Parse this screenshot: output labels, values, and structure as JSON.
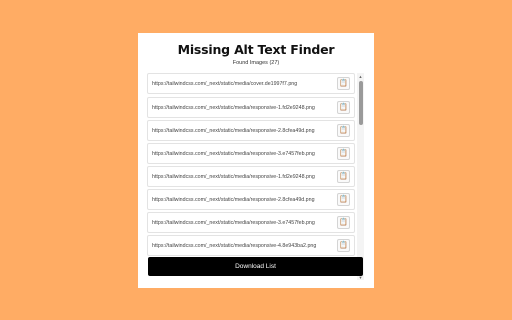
{
  "app": {
    "title": "Missing Alt Text Finder",
    "found_label": "Found Images (27)"
  },
  "images": [
    {
      "url": "https://tailwindcss.com/_next/static/media/cover.de1997f7.png"
    },
    {
      "url": "https://tailwindcss.com/_next/static/media/responsive-1.fd2e9248.png"
    },
    {
      "url": "https://tailwindcss.com/_next/static/media/responsive-2.8cfea49d.png"
    },
    {
      "url": "https://tailwindcss.com/_next/static/media/responsive-3.e7457feb.png"
    },
    {
      "url": "https://tailwindcss.com/_next/static/media/responsive-1.fd2e9248.png"
    },
    {
      "url": "https://tailwindcss.com/_next/static/media/responsive-2.8cfea49d.png"
    },
    {
      "url": "https://tailwindcss.com/_next/static/media/responsive-3.e7457feb.png"
    },
    {
      "url": "https://tailwindcss.com/_next/static/media/responsive-4.8e943ba2.png"
    }
  ],
  "icons": {
    "copy": "clipboard-icon",
    "scroll_up": "scroll-up-arrow-icon",
    "scroll_down": "scroll-down-arrow-icon"
  },
  "download_label": "Download List",
  "colors": {
    "background": "#ffac64",
    "panel": "#ffffff",
    "button": "#000000"
  }
}
